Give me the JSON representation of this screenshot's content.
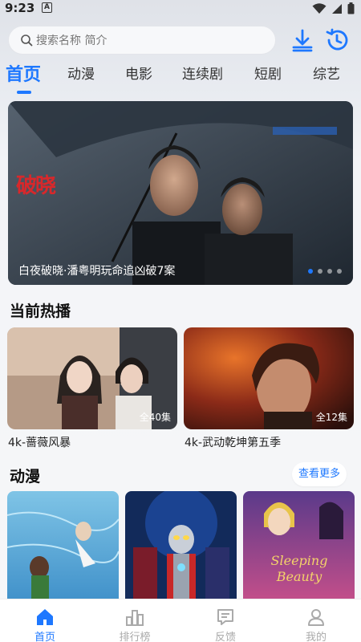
{
  "status_bar": {
    "time": "9:23",
    "notification_letter": "A"
  },
  "search": {
    "placeholder": "搜索名称 简介"
  },
  "tabs": [
    {
      "label": "首页",
      "active": true
    },
    {
      "label": "动漫"
    },
    {
      "label": "电影"
    },
    {
      "label": "连续剧"
    },
    {
      "label": "短剧"
    },
    {
      "label": "综艺"
    }
  ],
  "banner": {
    "logo_text": "破晓",
    "caption": "白夜破晓·潘粤明玩命追凶破7案",
    "dot_count": 4,
    "active_dot": 0
  },
  "now_playing": {
    "title": "当前热播",
    "items": [
      {
        "title": "4k-蔷薇风暴",
        "episodes": "全40集"
      },
      {
        "title": "4k-武动乾坤第五季",
        "episodes": "全12集"
      }
    ]
  },
  "anime": {
    "title": "动漫",
    "more_label": "查看更多",
    "items": [
      {
        "art_text": ""
      },
      {
        "art_text": ""
      },
      {
        "art_text": "Sleeping Beauty"
      }
    ]
  },
  "bottom_nav": [
    {
      "label": "首页",
      "icon": "home-icon",
      "active": true
    },
    {
      "label": "排行榜",
      "icon": "ranking-icon"
    },
    {
      "label": "反馈",
      "icon": "feedback-icon"
    },
    {
      "label": "我的",
      "icon": "profile-icon"
    }
  ],
  "colors": {
    "accent": "#1e78ff",
    "inactive": "#aaaaaa"
  }
}
